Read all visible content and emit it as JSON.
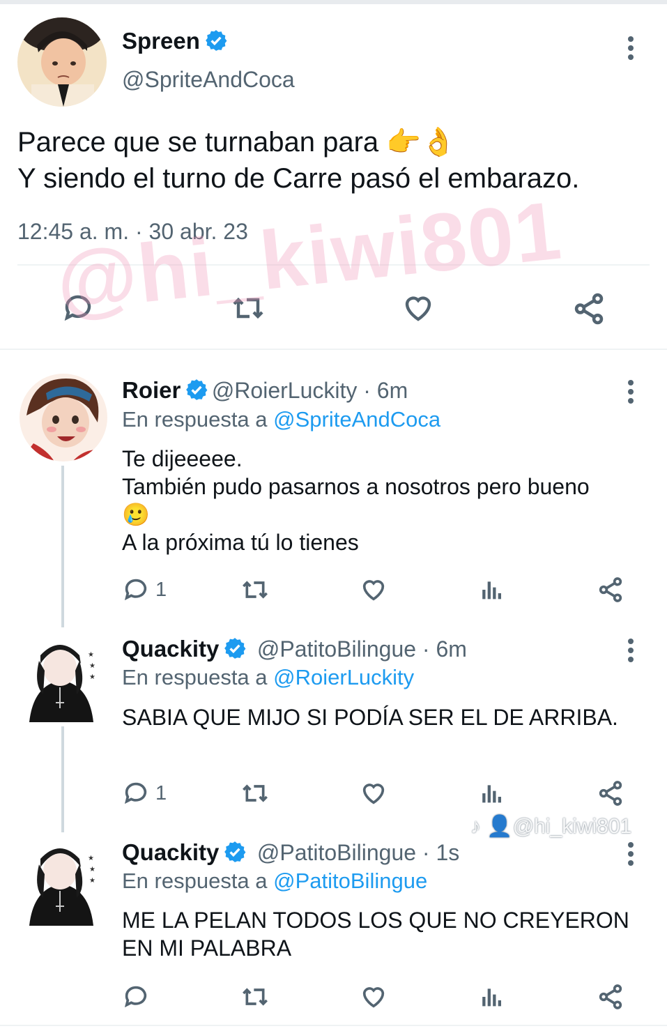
{
  "main_tweet": {
    "author_name": "Spreen",
    "author_handle": "@SpriteAndCoca",
    "text_line1": "Parece que se turnaban para 👉👌",
    "text_line2": "Y siendo el turno de Carre pasó el embarazo.",
    "timestamp": "12:45 a. m. · 30 abr. 23"
  },
  "replies": [
    {
      "author_name": "Roier",
      "author_handle": "@RoierLuckity",
      "age": " · 6m",
      "reply_prefix": "En respuesta a ",
      "reply_to": "@SpriteAndCoca",
      "text_line1": "Te dijeeeee.",
      "text_line2": "También pudo pasarnos a nosotros pero bueno",
      "text_line3": "🥲",
      "text_line4": "A la próxima tú lo tienes",
      "reply_count": "1"
    },
    {
      "author_name": "Quackity",
      "author_handle": "@PatitoBilingue",
      "age": " · 6m",
      "reply_prefix": "En respuesta a ",
      "reply_to": "@RoierLuckity",
      "text_line1": "SABIA QUE MIJO SI PODÍA SER EL DE ARRIBA.",
      "reply_count": "1"
    },
    {
      "author_name": "Quackity",
      "author_handle": "@PatitoBilingue",
      "age": " · 1s",
      "reply_prefix": "En respuesta a ",
      "reply_to": "@PatitoBilingue",
      "text_line1": "ME LA PELAN TODOS LOS QUE NO CREYERON",
      "text_line2": "EN MI PALABRA",
      "reply_count": ""
    }
  ],
  "watermarks": {
    "overlay": "@hi_kiwi801",
    "tiktok": "♪ 👤@hi_kiwi801"
  },
  "colors": {
    "accent": "#1d9bf0",
    "muted": "#536471",
    "watermark": "#f096b9"
  },
  "icons": [
    "reply-icon",
    "retweet-icon",
    "like-icon",
    "share-icon",
    "views-icon",
    "more-icon",
    "verified-badge-icon"
  ]
}
